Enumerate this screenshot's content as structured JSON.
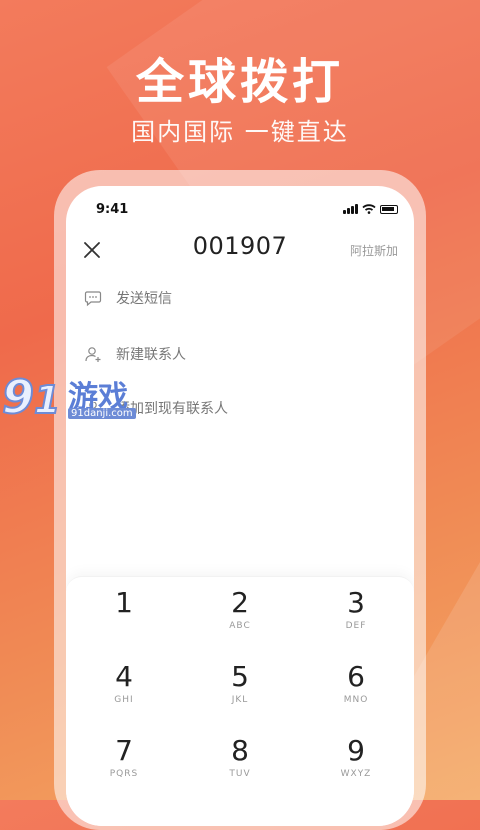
{
  "hero": {
    "title": "全球拨打",
    "subtitle": "国内国际  一键直达"
  },
  "status_bar": {
    "time": "9:41"
  },
  "dialer": {
    "number": "001907",
    "country": "阿拉斯加",
    "actions": [
      {
        "label": "发送短信",
        "icon": "message-icon"
      },
      {
        "label": "新建联系人",
        "icon": "add-person-icon"
      },
      {
        "label": "添加到现有联系人",
        "icon": "person-icon"
      }
    ],
    "keys": [
      {
        "digit": "1",
        "letters": ""
      },
      {
        "digit": "2",
        "letters": "ABC"
      },
      {
        "digit": "3",
        "letters": "DEF"
      },
      {
        "digit": "4",
        "letters": "GHI"
      },
      {
        "digit": "5",
        "letters": "JKL"
      },
      {
        "digit": "6",
        "letters": "MNO"
      },
      {
        "digit": "7",
        "letters": "PQRS"
      },
      {
        "digit": "8",
        "letters": "TUV"
      },
      {
        "digit": "9",
        "letters": "WXYZ"
      }
    ]
  },
  "watermark": {
    "brand": "游戏",
    "domain": "91danji.com"
  },
  "colors": {
    "background_top": "#ef6a4b",
    "background_bottom": "#f4a863",
    "watermark_blue": "#5b7ed6"
  }
}
